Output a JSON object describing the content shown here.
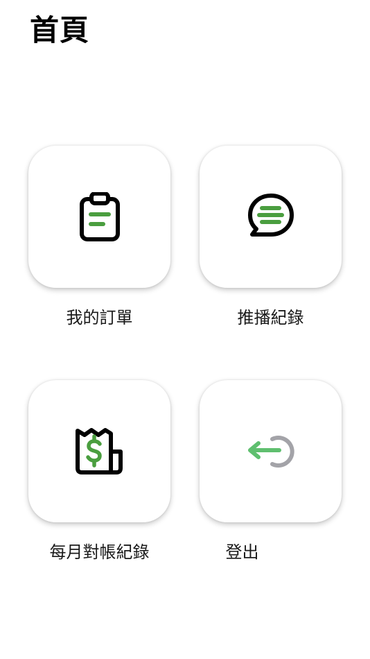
{
  "header": {
    "title": "首頁"
  },
  "menu": {
    "items": [
      {
        "label": "我的訂單",
        "icon": "clipboard-list-icon"
      },
      {
        "label": "推播紀錄",
        "icon": "chat-bubble-icon"
      },
      {
        "label": "每月對帳紀錄",
        "icon": "receipt-dollar-icon"
      },
      {
        "label": "登出",
        "icon": "logout-arrow-icon"
      }
    ]
  },
  "colors": {
    "icon_green": "#4a9e3f",
    "icon_stroke": "#000000",
    "logout_green": "#5fbf6f",
    "logout_gray": "#a3a3a8"
  }
}
